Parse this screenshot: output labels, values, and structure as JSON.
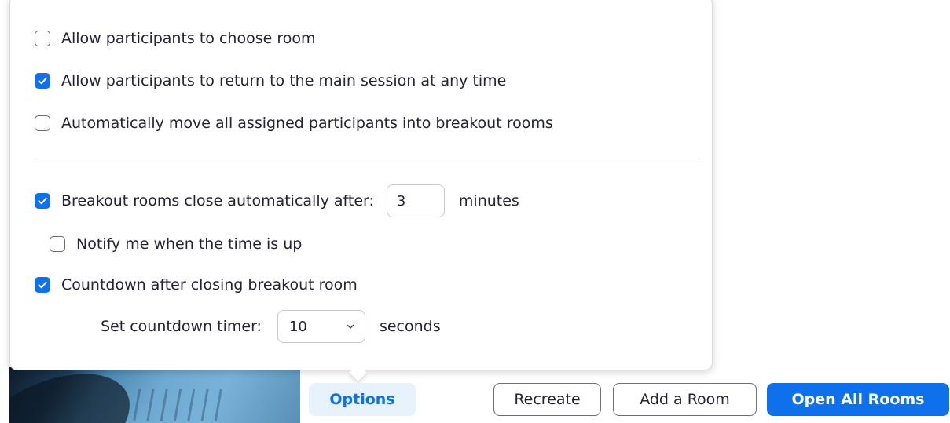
{
  "options_panel": {
    "choose_room": {
      "label": "Allow participants to choose room",
      "checked": false
    },
    "return_main": {
      "label": "Allow participants to return to the main session at any time",
      "checked": true
    },
    "auto_move": {
      "label": "Automatically move all assigned participants into breakout rooms",
      "checked": false
    },
    "auto_close": {
      "label": "Breakout rooms close automatically after:",
      "checked": true,
      "value": "3",
      "unit": "minutes"
    },
    "notify": {
      "label": "Notify me when the time is up",
      "checked": false
    },
    "countdown": {
      "label": "Countdown after closing breakout room",
      "checked": true
    },
    "countdown_timer": {
      "label": "Set countdown timer:",
      "value": "10",
      "unit": "seconds"
    }
  },
  "toolbar": {
    "options_label": "Options",
    "recreate_label": "Recreate",
    "add_room_label": "Add a Room",
    "open_all_label": "Open All Rooms"
  },
  "colors": {
    "accent": "#0e71eb",
    "options_bg": "#e8f2fd"
  }
}
